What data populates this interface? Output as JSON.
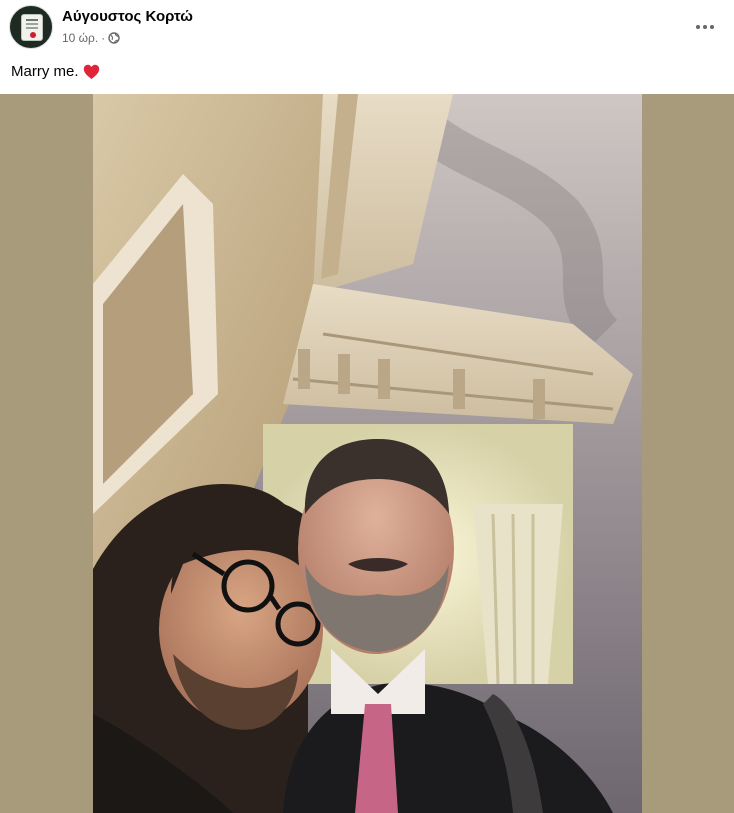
{
  "post": {
    "author": "Αύγουστος Κορτώ",
    "time": "10 ώρ.",
    "separator": "·",
    "audience_icon": "globe-icon",
    "more_icon": "more-options-icon",
    "caption": "Marry me.",
    "caption_emoji": "heart-icon"
  },
  "colors": {
    "media_background": "#a79b7c",
    "heart": "#e0243a",
    "meta_text": "#65676b"
  }
}
